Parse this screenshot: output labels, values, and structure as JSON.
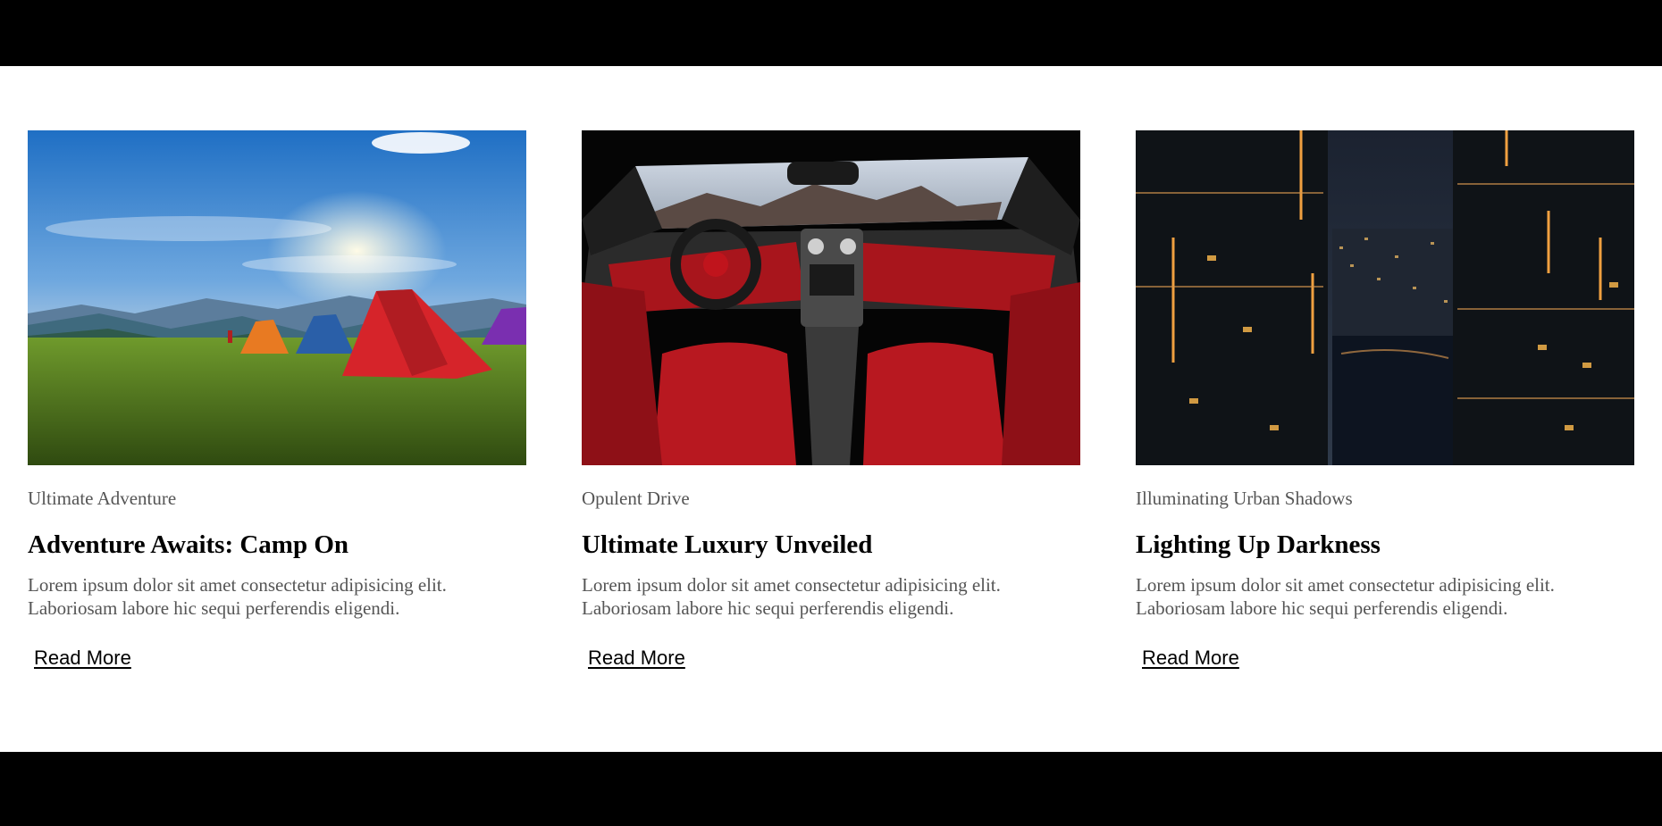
{
  "cards": [
    {
      "category": "Ultimate Adventure",
      "title": "Adventure Awaits: Camp On",
      "text": "Lorem ipsum dolor sit amet consectetur adipisicing elit. Laboriosam labore hic sequi perferendis eligendi.",
      "link_label": "Read More",
      "image_subject": "camping-tents-sunset-image"
    },
    {
      "category": "Opulent Drive",
      "title": "Ultimate Luxury Unveiled",
      "text": "Lorem ipsum dolor sit amet consectetur adipisicing elit. Laboriosam labore hic sequi perferendis eligendi.",
      "link_label": "Read More",
      "image_subject": "red-car-interior-image"
    },
    {
      "category": "Illuminating Urban Shadows",
      "title": "Lighting Up Darkness",
      "text": "Lorem ipsum dolor sit amet consectetur adipisicing elit. Laboriosam labore hic sequi perferendis eligendi.",
      "link_label": "Read More",
      "image_subject": "night-city-skyscrapers-image"
    }
  ],
  "colors": {
    "band": "#000000",
    "category_text": "#555555",
    "title_text": "#000000",
    "body_text": "#555555"
  }
}
